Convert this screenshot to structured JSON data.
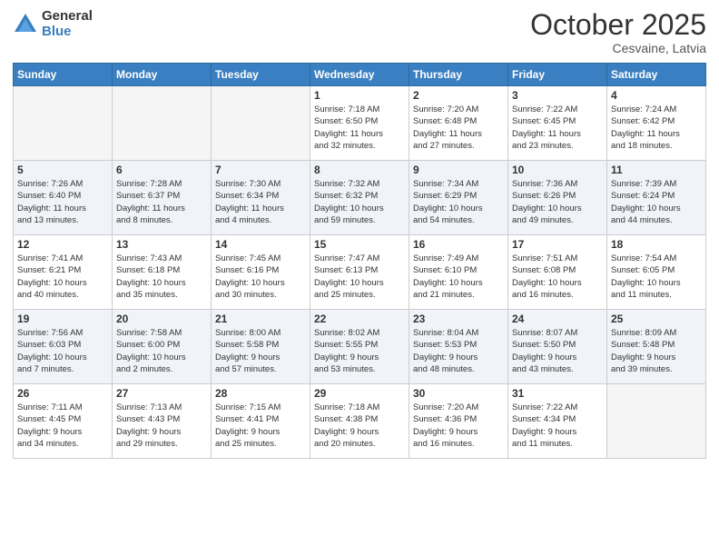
{
  "header": {
    "logo_general": "General",
    "logo_blue": "Blue",
    "month_title": "October 2025",
    "subtitle": "Cesvaine, Latvia"
  },
  "days_of_week": [
    "Sunday",
    "Monday",
    "Tuesday",
    "Wednesday",
    "Thursday",
    "Friday",
    "Saturday"
  ],
  "weeks": [
    [
      {
        "day": "",
        "info": ""
      },
      {
        "day": "",
        "info": ""
      },
      {
        "day": "",
        "info": ""
      },
      {
        "day": "1",
        "info": "Sunrise: 7:18 AM\nSunset: 6:50 PM\nDaylight: 11 hours\nand 32 minutes."
      },
      {
        "day": "2",
        "info": "Sunrise: 7:20 AM\nSunset: 6:48 PM\nDaylight: 11 hours\nand 27 minutes."
      },
      {
        "day": "3",
        "info": "Sunrise: 7:22 AM\nSunset: 6:45 PM\nDaylight: 11 hours\nand 23 minutes."
      },
      {
        "day": "4",
        "info": "Sunrise: 7:24 AM\nSunset: 6:42 PM\nDaylight: 11 hours\nand 18 minutes."
      }
    ],
    [
      {
        "day": "5",
        "info": "Sunrise: 7:26 AM\nSunset: 6:40 PM\nDaylight: 11 hours\nand 13 minutes."
      },
      {
        "day": "6",
        "info": "Sunrise: 7:28 AM\nSunset: 6:37 PM\nDaylight: 11 hours\nand 8 minutes."
      },
      {
        "day": "7",
        "info": "Sunrise: 7:30 AM\nSunset: 6:34 PM\nDaylight: 11 hours\nand 4 minutes."
      },
      {
        "day": "8",
        "info": "Sunrise: 7:32 AM\nSunset: 6:32 PM\nDaylight: 10 hours\nand 59 minutes."
      },
      {
        "day": "9",
        "info": "Sunrise: 7:34 AM\nSunset: 6:29 PM\nDaylight: 10 hours\nand 54 minutes."
      },
      {
        "day": "10",
        "info": "Sunrise: 7:36 AM\nSunset: 6:26 PM\nDaylight: 10 hours\nand 49 minutes."
      },
      {
        "day": "11",
        "info": "Sunrise: 7:39 AM\nSunset: 6:24 PM\nDaylight: 10 hours\nand 44 minutes."
      }
    ],
    [
      {
        "day": "12",
        "info": "Sunrise: 7:41 AM\nSunset: 6:21 PM\nDaylight: 10 hours\nand 40 minutes."
      },
      {
        "day": "13",
        "info": "Sunrise: 7:43 AM\nSunset: 6:18 PM\nDaylight: 10 hours\nand 35 minutes."
      },
      {
        "day": "14",
        "info": "Sunrise: 7:45 AM\nSunset: 6:16 PM\nDaylight: 10 hours\nand 30 minutes."
      },
      {
        "day": "15",
        "info": "Sunrise: 7:47 AM\nSunset: 6:13 PM\nDaylight: 10 hours\nand 25 minutes."
      },
      {
        "day": "16",
        "info": "Sunrise: 7:49 AM\nSunset: 6:10 PM\nDaylight: 10 hours\nand 21 minutes."
      },
      {
        "day": "17",
        "info": "Sunrise: 7:51 AM\nSunset: 6:08 PM\nDaylight: 10 hours\nand 16 minutes."
      },
      {
        "day": "18",
        "info": "Sunrise: 7:54 AM\nSunset: 6:05 PM\nDaylight: 10 hours\nand 11 minutes."
      }
    ],
    [
      {
        "day": "19",
        "info": "Sunrise: 7:56 AM\nSunset: 6:03 PM\nDaylight: 10 hours\nand 7 minutes."
      },
      {
        "day": "20",
        "info": "Sunrise: 7:58 AM\nSunset: 6:00 PM\nDaylight: 10 hours\nand 2 minutes."
      },
      {
        "day": "21",
        "info": "Sunrise: 8:00 AM\nSunset: 5:58 PM\nDaylight: 9 hours\nand 57 minutes."
      },
      {
        "day": "22",
        "info": "Sunrise: 8:02 AM\nSunset: 5:55 PM\nDaylight: 9 hours\nand 53 minutes."
      },
      {
        "day": "23",
        "info": "Sunrise: 8:04 AM\nSunset: 5:53 PM\nDaylight: 9 hours\nand 48 minutes."
      },
      {
        "day": "24",
        "info": "Sunrise: 8:07 AM\nSunset: 5:50 PM\nDaylight: 9 hours\nand 43 minutes."
      },
      {
        "day": "25",
        "info": "Sunrise: 8:09 AM\nSunset: 5:48 PM\nDaylight: 9 hours\nand 39 minutes."
      }
    ],
    [
      {
        "day": "26",
        "info": "Sunrise: 7:11 AM\nSunset: 4:45 PM\nDaylight: 9 hours\nand 34 minutes."
      },
      {
        "day": "27",
        "info": "Sunrise: 7:13 AM\nSunset: 4:43 PM\nDaylight: 9 hours\nand 29 minutes."
      },
      {
        "day": "28",
        "info": "Sunrise: 7:15 AM\nSunset: 4:41 PM\nDaylight: 9 hours\nand 25 minutes."
      },
      {
        "day": "29",
        "info": "Sunrise: 7:18 AM\nSunset: 4:38 PM\nDaylight: 9 hours\nand 20 minutes."
      },
      {
        "day": "30",
        "info": "Sunrise: 7:20 AM\nSunset: 4:36 PM\nDaylight: 9 hours\nand 16 minutes."
      },
      {
        "day": "31",
        "info": "Sunrise: 7:22 AM\nSunset: 4:34 PM\nDaylight: 9 hours\nand 11 minutes."
      },
      {
        "day": "",
        "info": ""
      }
    ]
  ]
}
